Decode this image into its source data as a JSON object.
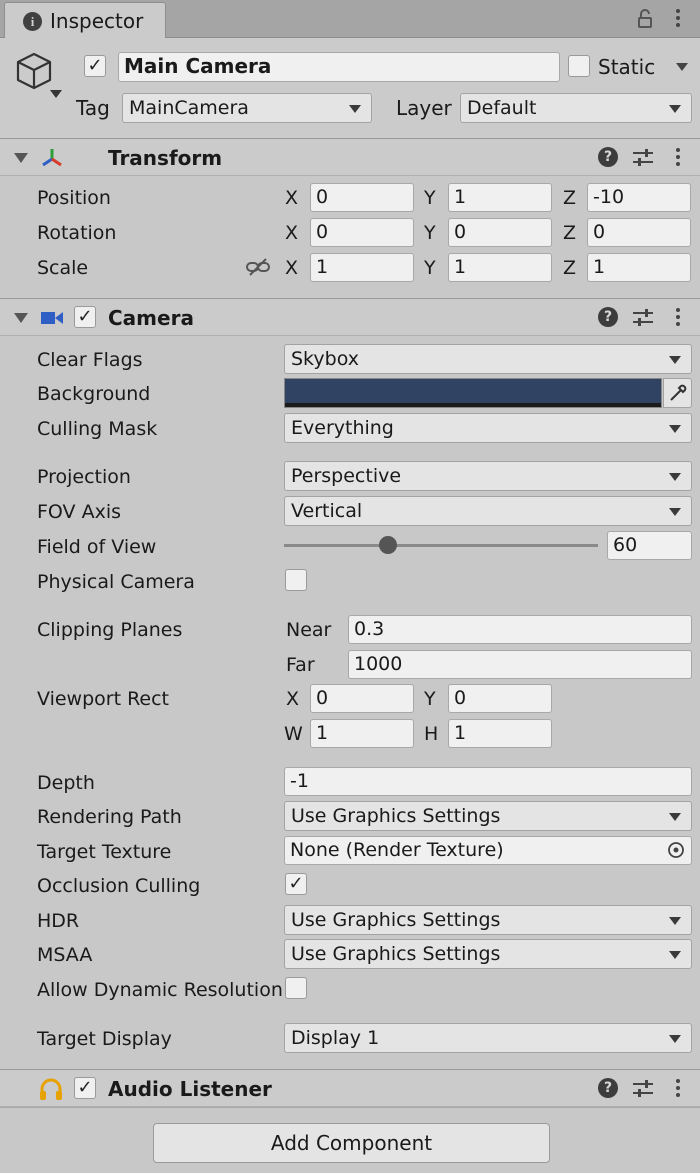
{
  "tab": {
    "title": "Inspector"
  },
  "gameobject": {
    "name": "Main Camera",
    "active": true,
    "static_label": "Static",
    "static_checked": false,
    "tag_label": "Tag",
    "tag_value": "MainCamera",
    "layer_label": "Layer",
    "layer_value": "Default"
  },
  "transform": {
    "title": "Transform",
    "position": {
      "label": "Position",
      "x": "0",
      "y": "1",
      "z": "-10"
    },
    "rotation": {
      "label": "Rotation",
      "x": "0",
      "y": "0",
      "z": "0"
    },
    "scale": {
      "label": "Scale",
      "x": "1",
      "y": "1",
      "z": "1"
    },
    "axis": {
      "x": "X",
      "y": "Y",
      "z": "Z"
    }
  },
  "camera": {
    "title": "Camera",
    "enabled": true,
    "clear_flags": {
      "label": "Clear Flags",
      "value": "Skybox"
    },
    "background": {
      "label": "Background",
      "color": "#314362"
    },
    "culling_mask": {
      "label": "Culling Mask",
      "value": "Everything"
    },
    "projection": {
      "label": "Projection",
      "value": "Perspective"
    },
    "fov_axis": {
      "label": "FOV Axis",
      "value": "Vertical"
    },
    "field_of_view": {
      "label": "Field of View",
      "value": "60",
      "slider_fraction": 0.33
    },
    "physical_camera": {
      "label": "Physical Camera",
      "checked": false
    },
    "clipping_planes": {
      "label": "Clipping Planes",
      "near_label": "Near",
      "near": "0.3",
      "far_label": "Far",
      "far": "1000"
    },
    "viewport_rect": {
      "label": "Viewport Rect",
      "x_label": "X",
      "x": "0",
      "y_label": "Y",
      "y": "0",
      "w_label": "W",
      "w": "1",
      "h_label": "H",
      "h": "1"
    },
    "depth": {
      "label": "Depth",
      "value": "-1"
    },
    "rendering_path": {
      "label": "Rendering Path",
      "value": "Use Graphics Settings"
    },
    "target_texture": {
      "label": "Target Texture",
      "value": "None (Render Texture)"
    },
    "occlusion_culling": {
      "label": "Occlusion Culling",
      "checked": true
    },
    "hdr": {
      "label": "HDR",
      "value": "Use Graphics Settings"
    },
    "msaa": {
      "label": "MSAA",
      "value": "Use Graphics Settings"
    },
    "allow_dynamic_resolution": {
      "label": "Allow Dynamic Resolution",
      "checked": false
    },
    "target_display": {
      "label": "Target Display",
      "value": "Display 1"
    }
  },
  "audio_listener": {
    "title": "Audio Listener",
    "enabled": true
  },
  "add_component": {
    "label": "Add Component"
  },
  "colors": {
    "panel": "#c8c8c8",
    "header": "#cbcbcb",
    "field": "#f0f0f0",
    "accent_audio": "#f0a500"
  }
}
